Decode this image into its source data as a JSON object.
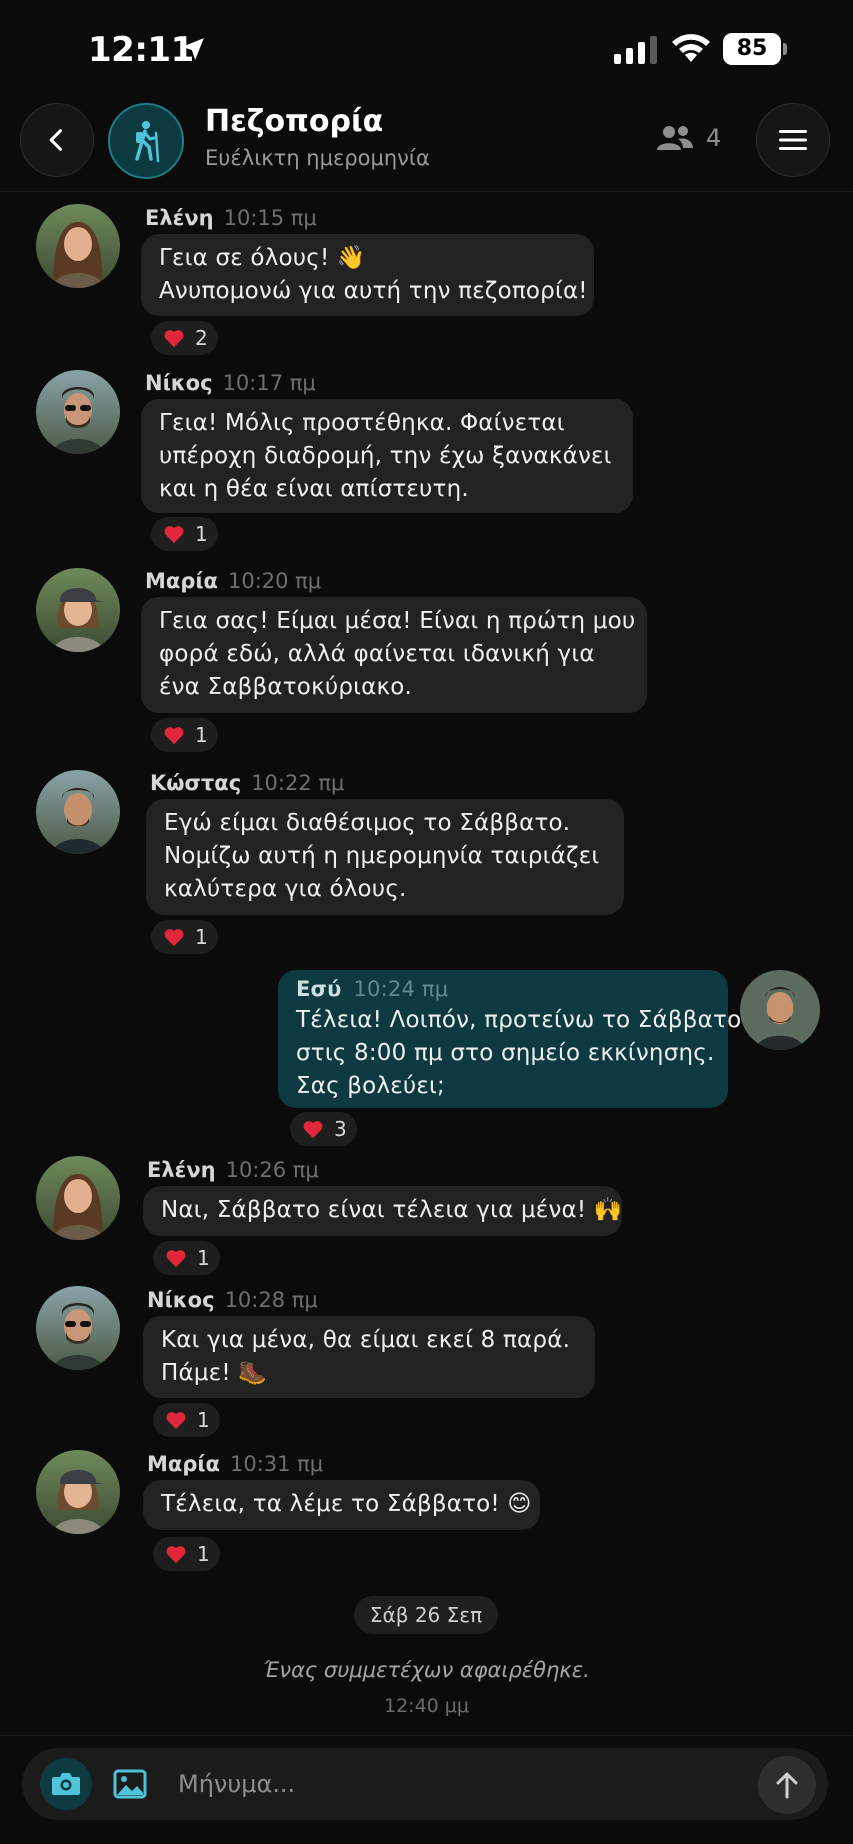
{
  "status_bar": {
    "time": "12:11",
    "battery": "85"
  },
  "header": {
    "title": "Πεζοπορία",
    "subtitle": "Ευέλικτη ημερομηνία",
    "member_count": "4"
  },
  "messages": [
    {
      "sender": "Ελένη",
      "time": "10:15 πμ",
      "lines": [
        "Γεια σε όλους! 👋",
        "Ανυπομονώ για αυτή την πεζοπορία!"
      ],
      "reaction_count": "2"
    },
    {
      "sender": "Νίκος",
      "time": "10:17 πμ",
      "lines": [
        "Γεια! Μόλις προστέθηκα. Φαίνεται",
        "υπέροχη διαδρομή, την έχω ξανακάνει",
        "και η θέα είναι απίστευτη."
      ],
      "reaction_count": "1"
    },
    {
      "sender": "Μαρία",
      "time": "10:20 πμ",
      "lines": [
        "Γεια σας! Είμαι μέσα! Είναι η πρώτη μου",
        "φορά εδώ, αλλά φαίνεται ιδανική για",
        "ένα Σαββατοκύριακο."
      ],
      "reaction_count": "1"
    },
    {
      "sender": "Κώστας",
      "time": "10:22 πμ",
      "lines": [
        "Εγώ είμαι διαθέσιμος το Σάββατο.",
        "Νομίζω αυτή η ημερομηνία ταιριάζει",
        "καλύτερα για όλους."
      ],
      "reaction_count": "1"
    },
    {
      "sender": "Εσύ",
      "time": "10:24 πμ",
      "lines": [
        "Τέλεια! Λοιπόν, προτείνω το Σάββατο",
        "στις 8:00 πμ στο σημείο εκκίνησης.",
        "Σας βολεύει;"
      ],
      "reaction_count": "3"
    },
    {
      "sender": "Ελένη",
      "time": "10:26 πμ",
      "lines": [
        "Ναι, Σάββατο είναι τέλεια για μένα! 🙌"
      ],
      "reaction_count": "1"
    },
    {
      "sender": "Νίκος",
      "time": "10:28 πμ",
      "lines": [
        "Και για μένα, θα είμαι εκεί 8 παρά.",
        "Πάμε! 🥾"
      ],
      "reaction_count": "1"
    },
    {
      "sender": "Μαρία",
      "time": "10:31 πμ",
      "lines": [
        "Τέλεια, τα λέμε το Σάββατο! 😊"
      ],
      "reaction_count": "1"
    }
  ],
  "date_divider": "Σάβ 26 Σεπ",
  "system_message": {
    "text": "Ένας συμμετέχων αφαιρέθηκε.",
    "time": "12:40 μμ"
  },
  "composer": {
    "placeholder": "Μήνυμα..."
  },
  "colors": {
    "accent": "#4fc3d9",
    "my_bubble": "#0d3a40",
    "bubble": "#222222",
    "background": "#0b0b0b"
  }
}
